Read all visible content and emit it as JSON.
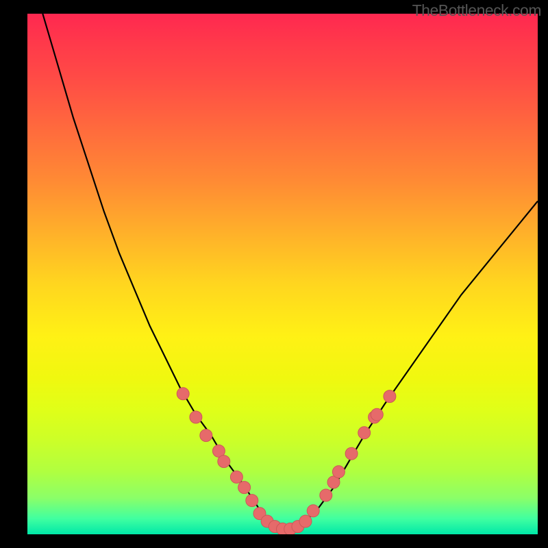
{
  "watermark": "TheBottleneck.com",
  "chart_data": {
    "type": "line",
    "title": "",
    "xlabel": "",
    "ylabel": "",
    "xlim": [
      0,
      100
    ],
    "ylim": [
      0,
      100
    ],
    "series": [
      {
        "name": "bottleneck-curve",
        "x": [
          3,
          6,
          9,
          12,
          15,
          18,
          21,
          24,
          27,
          30,
          33,
          36,
          39,
          42,
          44,
          46,
          48,
          50,
          52,
          54,
          57,
          60,
          63,
          66,
          70,
          75,
          80,
          85,
          90,
          95,
          100
        ],
        "y": [
          100,
          90,
          80,
          71,
          62,
          54,
          47,
          40,
          34,
          28,
          23,
          19,
          14,
          10,
          7,
          4,
          2,
          1,
          1,
          2,
          5,
          9,
          14,
          19,
          25,
          32,
          39,
          46,
          52,
          58,
          64
        ]
      }
    ],
    "markers": [
      {
        "x": 30.5,
        "y": 27
      },
      {
        "x": 33.0,
        "y": 22.5
      },
      {
        "x": 35.0,
        "y": 19
      },
      {
        "x": 37.5,
        "y": 16
      },
      {
        "x": 38.5,
        "y": 14
      },
      {
        "x": 41.0,
        "y": 11
      },
      {
        "x": 42.5,
        "y": 9
      },
      {
        "x": 44.0,
        "y": 6.5
      },
      {
        "x": 45.5,
        "y": 4
      },
      {
        "x": 47.0,
        "y": 2.5
      },
      {
        "x": 48.5,
        "y": 1.5
      },
      {
        "x": 50.0,
        "y": 1
      },
      {
        "x": 51.5,
        "y": 1
      },
      {
        "x": 53.0,
        "y": 1.5
      },
      {
        "x": 54.5,
        "y": 2.5
      },
      {
        "x": 56.0,
        "y": 4.5
      },
      {
        "x": 58.5,
        "y": 7.5
      },
      {
        "x": 60.0,
        "y": 10
      },
      {
        "x": 61.0,
        "y": 12
      },
      {
        "x": 63.5,
        "y": 15.5
      },
      {
        "x": 66.0,
        "y": 19.5
      },
      {
        "x": 68.0,
        "y": 22.5
      },
      {
        "x": 68.5,
        "y": 23
      },
      {
        "x": 71.0,
        "y": 26.5
      }
    ],
    "marker_style": {
      "fill": "#e66a6a",
      "stroke": "#cc5858",
      "radius": 9
    },
    "colors": {
      "line": "#000000",
      "background_top": "#ff2850",
      "background_bottom": "#00e8a8"
    }
  }
}
